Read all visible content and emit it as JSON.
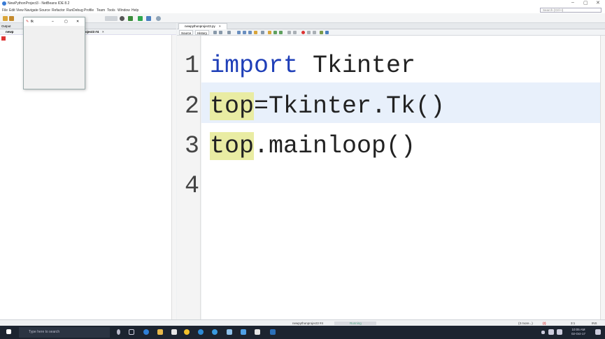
{
  "window": {
    "title": "NewPythonProject3 - NetBeans IDE 8.2",
    "minimize": "–",
    "maximize": "▢",
    "close": "✕"
  },
  "menu": [
    "File",
    "Edit",
    "View",
    "Navigate",
    "Source",
    "Refactor",
    "Run",
    "Debug",
    "Profile",
    "Team",
    "Tools",
    "Window",
    "Help"
  ],
  "search": {
    "placeholder": "Search (Ctrl+I)"
  },
  "left_pane": {
    "tab": "Output",
    "subtab_left": "newp",
    "subtab_right": "oject3 #4",
    "subtab_close": "×"
  },
  "tk_window": {
    "title": "tk",
    "minimize": "–",
    "maximize": "▢",
    "close": "✕"
  },
  "editor": {
    "file_tab": "newpythonproject3.py",
    "file_tab_close": "×",
    "source_tab": "Source",
    "history_tab": "History",
    "lines": [
      {
        "num": "1",
        "kw": "import",
        "rest": " Tkinter"
      },
      {
        "num": "2",
        "hl": "top",
        "rest": "=Tkinter.Tk()"
      },
      {
        "num": "3",
        "hl": "top",
        "rest": ".mainloop()"
      },
      {
        "num": "4"
      }
    ]
  },
  "status": {
    "project": "newpythonproject3 #4",
    "state": "Running",
    "mem": "(3 more...)",
    "pos": "3:1",
    "ins": "INS"
  },
  "taskbar": {
    "search_placeholder": "Type here to search",
    "time": "10:05 AM",
    "date": "02-Oct-17"
  },
  "colors": {
    "keyword": "#1f3fb8",
    "highlight": "#e9eca3",
    "current_line": "#e8f0fb",
    "taskbar": "#1c2430"
  }
}
